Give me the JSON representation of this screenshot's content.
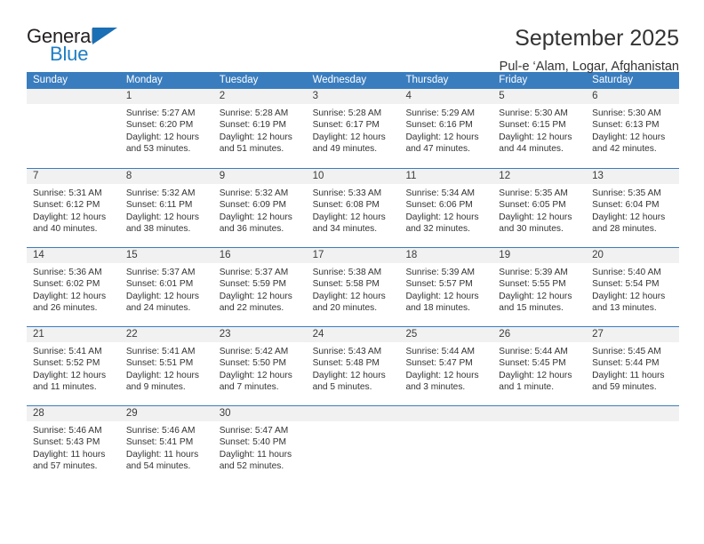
{
  "brand": {
    "word_one": "General",
    "word_two": "Blue",
    "flag_icon": "triangle-flag-icon",
    "accent_color": "#1a6fb5"
  },
  "header": {
    "title": "September 2025",
    "subtitle": "Pul-e ‘Alam, Logar, Afghanistan"
  },
  "calendar": {
    "header_color": "#3a7dbf",
    "day_band_color": "#f1f1f1",
    "weekdays": [
      "Sunday",
      "Monday",
      "Tuesday",
      "Wednesday",
      "Thursday",
      "Friday",
      "Saturday"
    ],
    "weeks": [
      [
        {
          "day": "",
          "lines": []
        },
        {
          "day": "1",
          "lines": [
            "Sunrise: 5:27 AM",
            "Sunset: 6:20 PM",
            "Daylight: 12 hours",
            "and 53 minutes."
          ]
        },
        {
          "day": "2",
          "lines": [
            "Sunrise: 5:28 AM",
            "Sunset: 6:19 PM",
            "Daylight: 12 hours",
            "and 51 minutes."
          ]
        },
        {
          "day": "3",
          "lines": [
            "Sunrise: 5:28 AM",
            "Sunset: 6:17 PM",
            "Daylight: 12 hours",
            "and 49 minutes."
          ]
        },
        {
          "day": "4",
          "lines": [
            "Sunrise: 5:29 AM",
            "Sunset: 6:16 PM",
            "Daylight: 12 hours",
            "and 47 minutes."
          ]
        },
        {
          "day": "5",
          "lines": [
            "Sunrise: 5:30 AM",
            "Sunset: 6:15 PM",
            "Daylight: 12 hours",
            "and 44 minutes."
          ]
        },
        {
          "day": "6",
          "lines": [
            "Sunrise: 5:30 AM",
            "Sunset: 6:13 PM",
            "Daylight: 12 hours",
            "and 42 minutes."
          ]
        }
      ],
      [
        {
          "day": "7",
          "lines": [
            "Sunrise: 5:31 AM",
            "Sunset: 6:12 PM",
            "Daylight: 12 hours",
            "and 40 minutes."
          ]
        },
        {
          "day": "8",
          "lines": [
            "Sunrise: 5:32 AM",
            "Sunset: 6:11 PM",
            "Daylight: 12 hours",
            "and 38 minutes."
          ]
        },
        {
          "day": "9",
          "lines": [
            "Sunrise: 5:32 AM",
            "Sunset: 6:09 PM",
            "Daylight: 12 hours",
            "and 36 minutes."
          ]
        },
        {
          "day": "10",
          "lines": [
            "Sunrise: 5:33 AM",
            "Sunset: 6:08 PM",
            "Daylight: 12 hours",
            "and 34 minutes."
          ]
        },
        {
          "day": "11",
          "lines": [
            "Sunrise: 5:34 AM",
            "Sunset: 6:06 PM",
            "Daylight: 12 hours",
            "and 32 minutes."
          ]
        },
        {
          "day": "12",
          "lines": [
            "Sunrise: 5:35 AM",
            "Sunset: 6:05 PM",
            "Daylight: 12 hours",
            "and 30 minutes."
          ]
        },
        {
          "day": "13",
          "lines": [
            "Sunrise: 5:35 AM",
            "Sunset: 6:04 PM",
            "Daylight: 12 hours",
            "and 28 minutes."
          ]
        }
      ],
      [
        {
          "day": "14",
          "lines": [
            "Sunrise: 5:36 AM",
            "Sunset: 6:02 PM",
            "Daylight: 12 hours",
            "and 26 minutes."
          ]
        },
        {
          "day": "15",
          "lines": [
            "Sunrise: 5:37 AM",
            "Sunset: 6:01 PM",
            "Daylight: 12 hours",
            "and 24 minutes."
          ]
        },
        {
          "day": "16",
          "lines": [
            "Sunrise: 5:37 AM",
            "Sunset: 5:59 PM",
            "Daylight: 12 hours",
            "and 22 minutes."
          ]
        },
        {
          "day": "17",
          "lines": [
            "Sunrise: 5:38 AM",
            "Sunset: 5:58 PM",
            "Daylight: 12 hours",
            "and 20 minutes."
          ]
        },
        {
          "day": "18",
          "lines": [
            "Sunrise: 5:39 AM",
            "Sunset: 5:57 PM",
            "Daylight: 12 hours",
            "and 18 minutes."
          ]
        },
        {
          "day": "19",
          "lines": [
            "Sunrise: 5:39 AM",
            "Sunset: 5:55 PM",
            "Daylight: 12 hours",
            "and 15 minutes."
          ]
        },
        {
          "day": "20",
          "lines": [
            "Sunrise: 5:40 AM",
            "Sunset: 5:54 PM",
            "Daylight: 12 hours",
            "and 13 minutes."
          ]
        }
      ],
      [
        {
          "day": "21",
          "lines": [
            "Sunrise: 5:41 AM",
            "Sunset: 5:52 PM",
            "Daylight: 12 hours",
            "and 11 minutes."
          ]
        },
        {
          "day": "22",
          "lines": [
            "Sunrise: 5:41 AM",
            "Sunset: 5:51 PM",
            "Daylight: 12 hours",
            "and 9 minutes."
          ]
        },
        {
          "day": "23",
          "lines": [
            "Sunrise: 5:42 AM",
            "Sunset: 5:50 PM",
            "Daylight: 12 hours",
            "and 7 minutes."
          ]
        },
        {
          "day": "24",
          "lines": [
            "Sunrise: 5:43 AM",
            "Sunset: 5:48 PM",
            "Daylight: 12 hours",
            "and 5 minutes."
          ]
        },
        {
          "day": "25",
          "lines": [
            "Sunrise: 5:44 AM",
            "Sunset: 5:47 PM",
            "Daylight: 12 hours",
            "and 3 minutes."
          ]
        },
        {
          "day": "26",
          "lines": [
            "Sunrise: 5:44 AM",
            "Sunset: 5:45 PM",
            "Daylight: 12 hours",
            "and 1 minute."
          ]
        },
        {
          "day": "27",
          "lines": [
            "Sunrise: 5:45 AM",
            "Sunset: 5:44 PM",
            "Daylight: 11 hours",
            "and 59 minutes."
          ]
        }
      ],
      [
        {
          "day": "28",
          "lines": [
            "Sunrise: 5:46 AM",
            "Sunset: 5:43 PM",
            "Daylight: 11 hours",
            "and 57 minutes."
          ]
        },
        {
          "day": "29",
          "lines": [
            "Sunrise: 5:46 AM",
            "Sunset: 5:41 PM",
            "Daylight: 11 hours",
            "and 54 minutes."
          ]
        },
        {
          "day": "30",
          "lines": [
            "Sunrise: 5:47 AM",
            "Sunset: 5:40 PM",
            "Daylight: 11 hours",
            "and 52 minutes."
          ]
        },
        {
          "day": "",
          "lines": []
        },
        {
          "day": "",
          "lines": []
        },
        {
          "day": "",
          "lines": []
        },
        {
          "day": "",
          "lines": []
        }
      ]
    ]
  }
}
